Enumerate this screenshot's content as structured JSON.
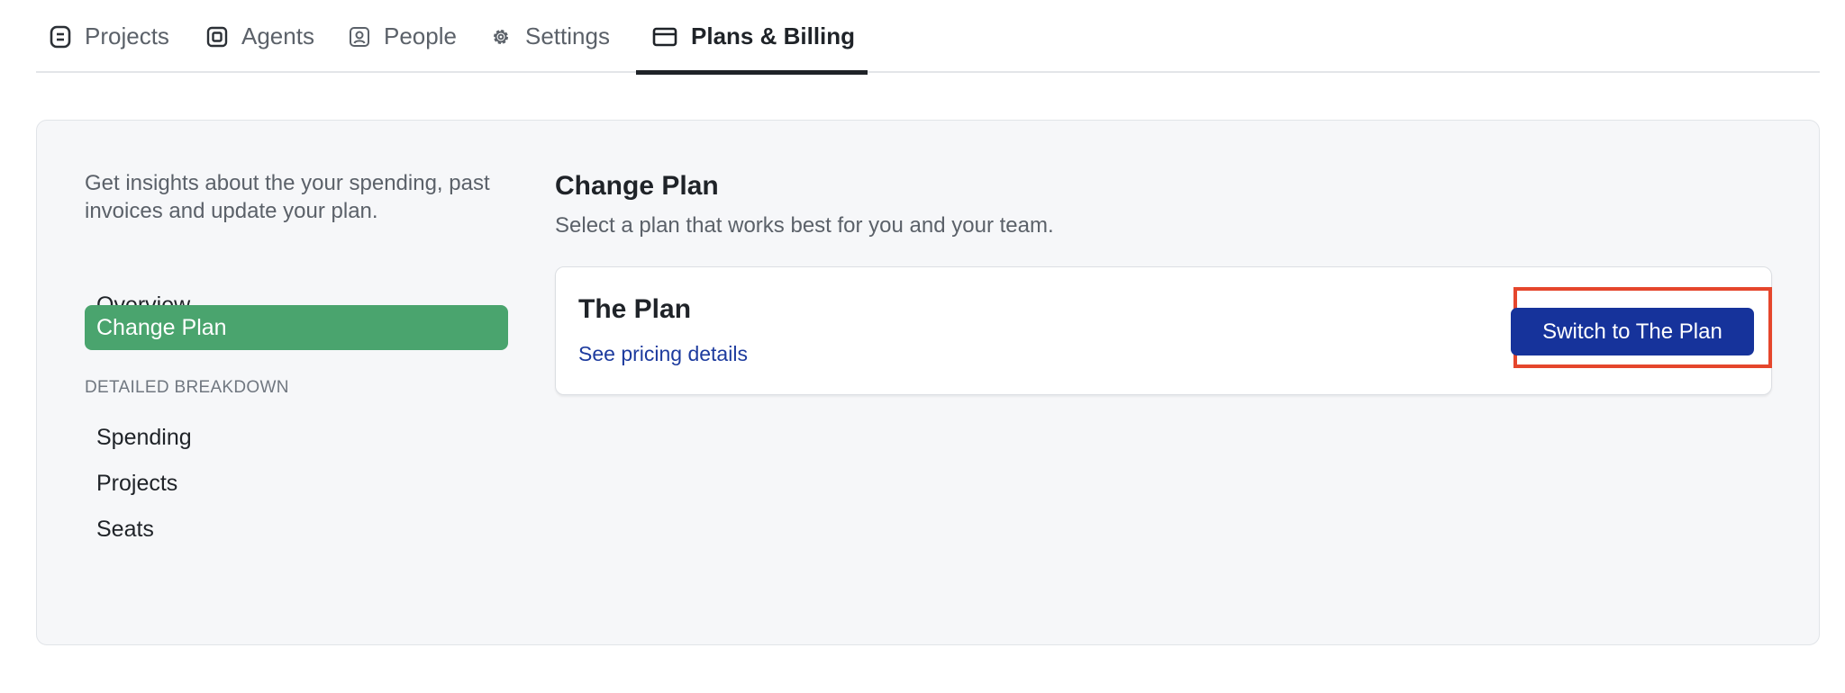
{
  "tabs": [
    {
      "label": "Projects",
      "icon": "projects-icon",
      "active": false
    },
    {
      "label": "Agents",
      "icon": "agents-icon",
      "active": false
    },
    {
      "label": "People",
      "icon": "people-icon",
      "active": false
    },
    {
      "label": "Settings",
      "icon": "gear-icon",
      "active": false
    },
    {
      "label": "Plans & Billing",
      "icon": "credit-card-icon",
      "active": true
    }
  ],
  "sidebar": {
    "intro": "Get insights about the your spending, past invoices and update your plan.",
    "items": [
      {
        "label": "Overview",
        "active": false
      },
      {
        "label": "Change Plan",
        "active": true
      }
    ],
    "section_label": "DETAILED BREAKDOWN",
    "breakdown_items": [
      {
        "label": "Spending"
      },
      {
        "label": "Projects"
      },
      {
        "label": "Seats"
      }
    ]
  },
  "main": {
    "title": "Change Plan",
    "subtitle": "Select a plan that works best for you and your team.",
    "plan": {
      "name": "The Plan",
      "link_label": "See pricing details",
      "button_label": "Switch to The Plan"
    }
  },
  "colors": {
    "accent_green": "#4aa46e",
    "primary_button": "#16339b",
    "link": "#1d3b9e",
    "highlight_box": "#e5462c"
  }
}
